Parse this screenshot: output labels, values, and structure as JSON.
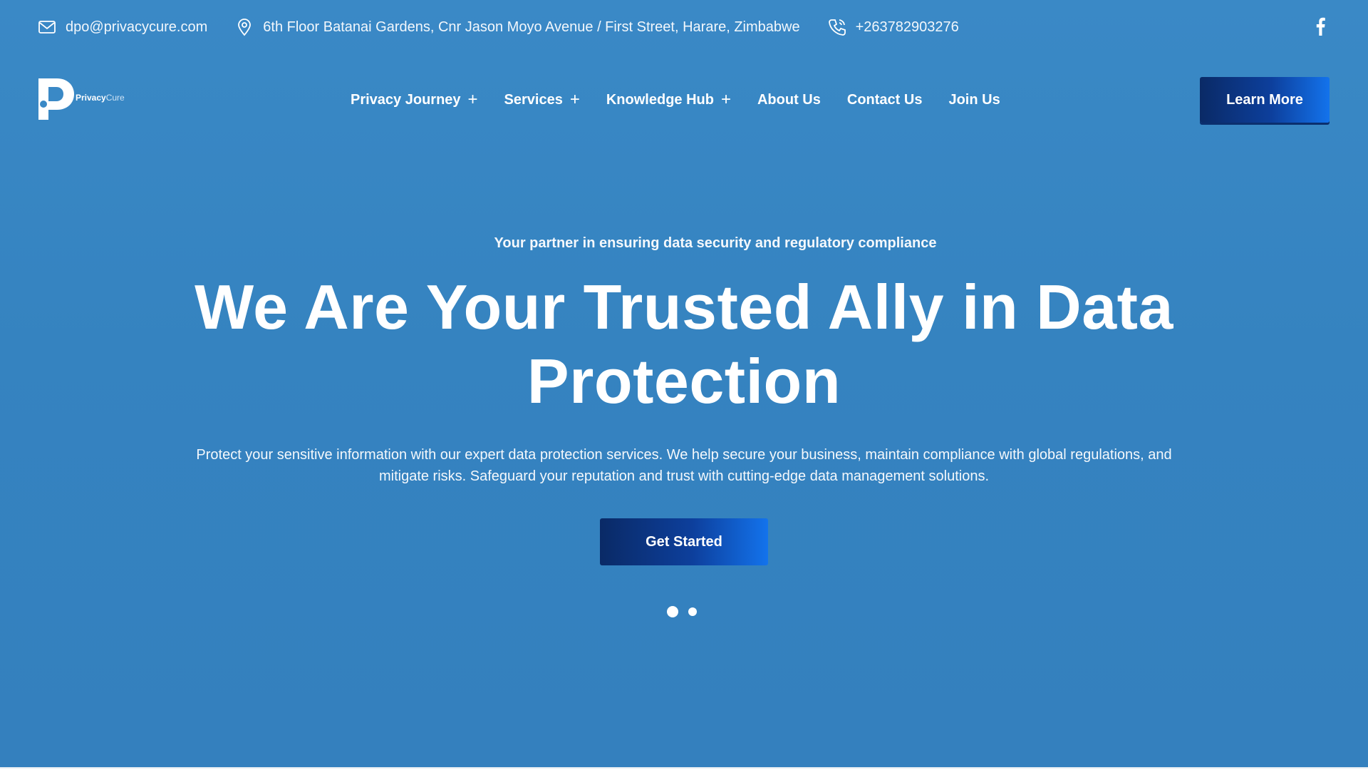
{
  "topbar": {
    "email": "dpo@privacycure.com",
    "address": "6th Floor Batanai Gardens, Cnr Jason Moyo Avenue / First Street, Harare, Zimbabwe",
    "phone": "+263782903276",
    "icons": [
      "mail-icon",
      "location-pin-icon",
      "phone-icon",
      "facebook-icon"
    ]
  },
  "brand": {
    "name_bold": "Privacy",
    "name_light": "Cure"
  },
  "nav": {
    "items": [
      {
        "label": "Privacy Journey",
        "expand": "+"
      },
      {
        "label": "Services",
        "expand": "+"
      },
      {
        "label": "Knowledge Hub",
        "expand": "+"
      },
      {
        "label": "About Us"
      },
      {
        "label": "Contact Us"
      },
      {
        "label": "Join Us"
      }
    ],
    "cta_label": "Learn More"
  },
  "hero": {
    "tagline": "Your partner in ensuring data security and regulatory compliance",
    "headline_line1": "We Are Your Trusted Ally in Data",
    "headline_line2": "Protection",
    "description": "Protect your sensitive information with our expert data protection services. We help secure your business, maintain compliance with global regulations, and mitigate risks. Safeguard your reputation and trust with cutting-edge data management solutions.",
    "button_label": "Get Started"
  },
  "carousel": {
    "slide_count": 2,
    "active_slide": 1
  },
  "colors": {
    "background": "#3583c0",
    "button_gradient_start": "#0a2a66",
    "button_gradient_end": "#1373ec",
    "text": "#ffffff"
  }
}
